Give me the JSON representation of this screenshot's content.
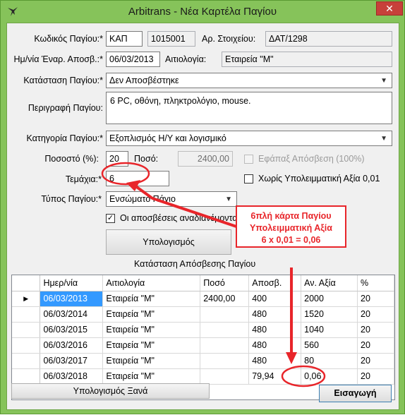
{
  "window": {
    "title": "Arbitrans - Νέα Καρτέλα Παγίου",
    "close": "✕"
  },
  "form": {
    "code_label": "Κωδικός Παγίου:*",
    "code_prefix": "ΚΑΠ",
    "code_number": "1015001",
    "doc_label": "Αρ. Στοιχείου:",
    "doc_value": "ΔΑΤ/1298",
    "start_label": "Ημ/νία Έναρ. Αποσβ.:*",
    "start_value": "06/03/2013",
    "reason_label": "Αιτιολογία:",
    "reason_value": "Εταιρεία \"Μ\"",
    "status_label": "Κατάσταση Παγίου:*",
    "status_value": "Δεν Αποσβέστηκε",
    "desc_label": "Περιγραφή Παγίου:",
    "desc_value": "6 PC, οθόνη, πληκτρολόγιο, mouse.",
    "category_label": "Κατηγορία Παγίου:*",
    "category_value": "Εξοπλισμός Η/Υ και λογισμικό",
    "percent_label": "Ποσοστό (%):",
    "percent_value": "20",
    "amount_label": "Ποσό:",
    "amount_value": "2400,00",
    "once_label": "Εφάπαξ Απόσβεση (100%)",
    "pieces_label": "Τεμάχια:*",
    "pieces_value": "6",
    "no_residual_label": "Χωρίς Υπολειμματική Αξία 0,01",
    "type_label": "Τύπος Παγίου:*",
    "type_value": "Ενσώματο Πάγιο",
    "redistribute_label": "Οι αποσβέσεις αναδιανέμονται στο Ε3",
    "calc_button": "Υπολογισμός",
    "status_table_title": "Κατάσταση Απόσβεσης Παγίου"
  },
  "grid": {
    "columns": [
      "Ημερ/νία",
      "Αιτιολογία",
      "Ποσό",
      "Αποσβ.",
      "Αν. Αξία",
      "%"
    ],
    "rows": [
      [
        "06/03/2013",
        "Εταιρεία \"Μ\"",
        "2400,00",
        "400",
        "2000",
        "20"
      ],
      [
        "06/03/2014",
        "Εταιρεία \"Μ\"",
        "",
        "480",
        "1520",
        "20"
      ],
      [
        "06/03/2015",
        "Εταιρεία \"Μ\"",
        "",
        "480",
        "1040",
        "20"
      ],
      [
        "06/03/2016",
        "Εταιρεία \"Μ\"",
        "",
        "480",
        "560",
        "20"
      ],
      [
        "06/03/2017",
        "Εταιρεία \"Μ\"",
        "",
        "480",
        "80",
        "20"
      ],
      [
        "06/03/2018",
        "Εταιρεία \"Μ\"",
        "",
        "79,94",
        "0,06",
        "20"
      ]
    ]
  },
  "footer": {
    "recalc_button": "Υπολογισμός Ξανά",
    "insert_button": "Εισαγωγή"
  },
  "annotation": {
    "line1": "6πλή κάρτα Παγίου",
    "line2": "Υπολειμματική Αξία",
    "line3": "6 x 0,01 = 0,06",
    "color": "#e8252a"
  },
  "icons": {
    "app": "bird-logo-icon",
    "close": "close-icon",
    "dropdown": "chevron-down-icon",
    "row_pointer": "row-pointer-icon"
  }
}
